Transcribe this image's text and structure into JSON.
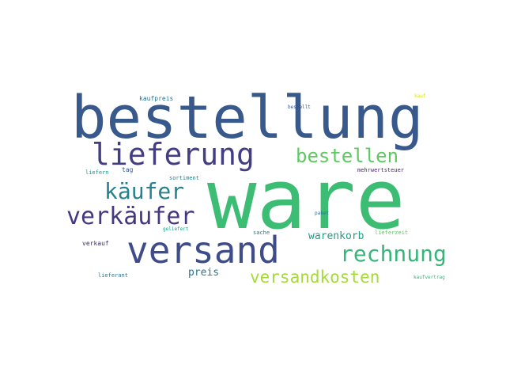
{
  "words": {
    "ware": {
      "text": "ware",
      "color": "#3dbc74"
    },
    "bestellung": {
      "text": "bestellung",
      "color": "#38598c"
    },
    "lieferung": {
      "text": "lieferung",
      "color": "#433d84"
    },
    "versand": {
      "text": "versand",
      "color": "#3e4c8a"
    },
    "verkaeufer": {
      "text": "verkäufer",
      "color": "#453781"
    },
    "kaeufer": {
      "text": "käufer",
      "color": "#26828e"
    },
    "bestellen": {
      "text": "bestellen",
      "color": "#5ec962"
    },
    "rechnung": {
      "text": "rechnung",
      "color": "#35b779"
    },
    "versandkosten": {
      "text": "versandkosten",
      "color": "#a5db36"
    },
    "warenkorb": {
      "text": "warenkorb",
      "color": "#1f9e89"
    },
    "preis": {
      "text": "preis",
      "color": "#2a788e"
    },
    "kaufpreis": {
      "text": "kaufpreis",
      "color": "#2c728e"
    },
    "kauf": {
      "text": "kauf",
      "color": "#d8e219"
    },
    "bestellt": {
      "text": "bestellt",
      "color": "#3b528b"
    },
    "tag": {
      "text": "tag",
      "color": "#3b528b"
    },
    "liefern": {
      "text": "liefern",
      "color": "#21918c"
    },
    "sortiment": {
      "text": "sortiment",
      "color": "#25848e"
    },
    "mehrwertsteuer": {
      "text": "mehrwertsteuer",
      "color": "#482475"
    },
    "paket": {
      "text": "paket",
      "color": "#2d708e"
    },
    "geliefert": {
      "text": "geliefert",
      "color": "#1fa088"
    },
    "sache": {
      "text": "sache",
      "color": "#287c8e"
    },
    "lieferzeit": {
      "text": "lieferzeit",
      "color": "#5ec962"
    },
    "verkauf": {
      "text": "verkauf",
      "color": "#472c7a"
    },
    "lieferant": {
      "text": "lieferant",
      "color": "#2a788e"
    },
    "kaufvertrag": {
      "text": "kaufvertrag",
      "color": "#35b779"
    }
  }
}
